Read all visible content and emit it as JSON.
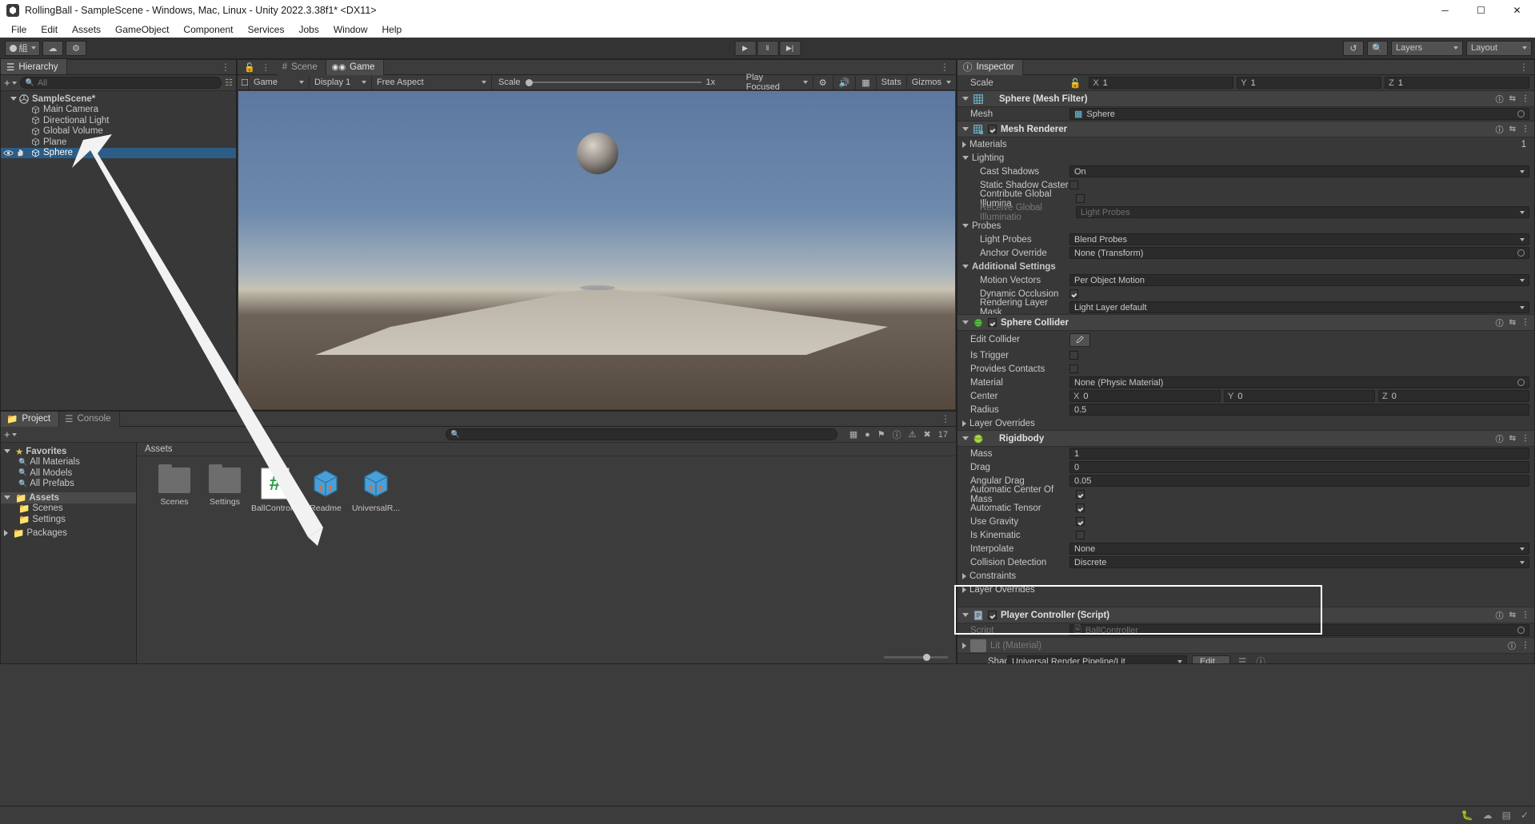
{
  "window": {
    "title": "RollingBall - SampleScene - Windows, Mac, Linux - Unity 2022.3.38f1* <DX11>",
    "minimize": "─",
    "maximize": "☐",
    "close": "✕"
  },
  "menu": [
    "File",
    "Edit",
    "Assets",
    "GameObject",
    "Component",
    "Services",
    "Jobs",
    "Window",
    "Help"
  ],
  "toolbar": {
    "account_label": "組",
    "cloud_label": "☁",
    "settings_label": "⚙",
    "play": "▶",
    "pause": "‖",
    "step": "▶|",
    "history_icon": "history-icon",
    "search_icon": "search-icon",
    "layers_label": "Layers",
    "layout_label": "Layout"
  },
  "hierarchy": {
    "tab": "Hierarchy",
    "search_placeholder": "All",
    "plus_label": "+",
    "items": [
      {
        "label": "SampleScene*",
        "depth": 0,
        "type": "scene",
        "selected": false
      },
      {
        "label": "Main Camera",
        "depth": 1,
        "type": "gameobject",
        "selected": false
      },
      {
        "label": "Directional Light",
        "depth": 1,
        "type": "gameobject",
        "selected": false
      },
      {
        "label": "Global Volume",
        "depth": 1,
        "type": "gameobject",
        "selected": false
      },
      {
        "label": "Plane",
        "depth": 1,
        "type": "gameobject",
        "selected": false
      },
      {
        "label": "Sphere",
        "depth": 1,
        "type": "gameobject",
        "selected": true
      }
    ]
  },
  "gameview": {
    "tabs": [
      {
        "label": "Scene",
        "active": false,
        "icon": "grid-icon"
      },
      {
        "label": "Game",
        "active": true,
        "icon": "gamepad-icon"
      }
    ],
    "view_mode": "Game",
    "display": "Display 1",
    "aspect": "Free Aspect",
    "scale_label": "Scale",
    "scale_value": "1x",
    "play_mode": "Play Focused",
    "stats": "Stats",
    "gizmos": "Gizmos",
    "mute_icon": "audio-icon",
    "stats_icon": "stats-icon"
  },
  "inspector": {
    "tab": "Inspector",
    "scale_row": {
      "label": "Scale",
      "lock_icon": "lock-icon",
      "x_label": "X",
      "x": "1",
      "y_label": "Y",
      "y": "1",
      "z_label": "Z",
      "z": "1"
    },
    "components": [
      {
        "name": "Sphere (Mesh Filter)",
        "icon": "mesh-filter-icon",
        "has_checkbox": false,
        "rows": [
          {
            "label": "Mesh",
            "type": "object",
            "value": "Sphere"
          }
        ]
      },
      {
        "name": "Mesh Renderer",
        "icon": "mesh-renderer-icon",
        "has_checkbox": true,
        "enabled": true,
        "rows": [
          {
            "label": "Materials",
            "type": "foldout_closed",
            "value": "1"
          },
          {
            "label": "Lighting",
            "type": "foldout_open"
          },
          {
            "label": "Cast Shadows",
            "type": "dropdown",
            "value": "On",
            "indent": 2
          },
          {
            "label": "Static Shadow Caster",
            "type": "checkbox",
            "value": false,
            "indent": 2
          },
          {
            "label": "Contribute Global Illumina",
            "type": "checkbox",
            "value": false,
            "indent": 2
          },
          {
            "label": "Receive Global Illuminatio",
            "type": "dropdown",
            "value": "Light Probes",
            "indent": 2,
            "disabled": true
          },
          {
            "label": "Probes",
            "type": "foldout_open"
          },
          {
            "label": "Light Probes",
            "type": "dropdown",
            "value": "Blend Probes",
            "indent": 2
          },
          {
            "label": "Anchor Override",
            "type": "object",
            "value": "None (Transform)",
            "indent": 2
          },
          {
            "label": "Additional Settings",
            "type": "foldout_open"
          },
          {
            "label": "Motion Vectors",
            "type": "dropdown",
            "value": "Per Object Motion",
            "indent": 2
          },
          {
            "label": "Dynamic Occlusion",
            "type": "checkbox",
            "value": true,
            "indent": 2
          },
          {
            "label": "Rendering Layer Mask",
            "type": "dropdown",
            "value": "Light Layer default",
            "indent": 2
          }
        ]
      },
      {
        "name": "Sphere Collider",
        "icon": "collider-icon",
        "has_checkbox": true,
        "enabled": true,
        "rows": [
          {
            "label": "Edit Collider",
            "type": "button",
            "value": "edit-collider-icon"
          },
          {
            "label": "Is Trigger",
            "type": "checkbox",
            "value": false
          },
          {
            "label": "Provides Contacts",
            "type": "checkbox",
            "value": false
          },
          {
            "label": "Material",
            "type": "object",
            "value": "None (Physic Material)"
          },
          {
            "label": "Center",
            "type": "vector3",
            "x": "0",
            "y": "0",
            "z": "0"
          },
          {
            "label": "Radius",
            "type": "text",
            "value": "0.5"
          },
          {
            "label": "Layer Overrides",
            "type": "foldout_closed"
          }
        ]
      },
      {
        "name": "Rigidbody",
        "icon": "rigidbody-icon",
        "has_checkbox": false,
        "rows": [
          {
            "label": "Mass",
            "type": "text",
            "value": "1"
          },
          {
            "label": "Drag",
            "type": "text",
            "value": "0"
          },
          {
            "label": "Angular Drag",
            "type": "text",
            "value": "0.05"
          },
          {
            "label": "Automatic Center Of Mass",
            "type": "checkbox",
            "value": true
          },
          {
            "label": "Automatic Tensor",
            "type": "checkbox",
            "value": true
          },
          {
            "label": "Use Gravity",
            "type": "checkbox",
            "value": true
          },
          {
            "label": "Is Kinematic",
            "type": "checkbox",
            "value": false
          },
          {
            "label": "Interpolate",
            "type": "dropdown",
            "value": "None"
          },
          {
            "label": "Collision Detection",
            "type": "dropdown",
            "value": "Discrete"
          },
          {
            "label": "Constraints",
            "type": "foldout_closed"
          },
          {
            "label": "Layer Overrides",
            "type": "foldout_closed"
          }
        ]
      },
      {
        "name": "Player Controller (Script)",
        "icon": "script-icon",
        "has_checkbox": true,
        "enabled": true,
        "highlighted": true,
        "rows": [
          {
            "label": "Script",
            "type": "object",
            "value": "BallController",
            "disabled": true
          }
        ]
      }
    ],
    "material_preview": {
      "title": "Lit (Material)",
      "shader_label": "Shader",
      "shader_value": "Universal Render Pipeline/Lit",
      "edit_label": "Edit..."
    }
  },
  "project": {
    "tabs": [
      {
        "label": "Project",
        "active": true,
        "icon": "folder-icon"
      },
      {
        "label": "Console",
        "active": false,
        "icon": "console-icon"
      }
    ],
    "plus_label": "+",
    "search_placeholder": "",
    "counter": "17",
    "breadcrumb": "Assets",
    "tree": [
      {
        "label": "Favorites",
        "depth": 0,
        "type": "star",
        "expanded": true
      },
      {
        "label": "All Materials",
        "depth": 1,
        "type": "search"
      },
      {
        "label": "All Models",
        "depth": 1,
        "type": "search"
      },
      {
        "label": "All Prefabs",
        "depth": 1,
        "type": "search"
      },
      {
        "label": "Assets",
        "depth": 0,
        "type": "folder",
        "expanded": true,
        "selected": true
      },
      {
        "label": "Scenes",
        "depth": 1,
        "type": "folder"
      },
      {
        "label": "Settings",
        "depth": 1,
        "type": "folder"
      },
      {
        "label": "Packages",
        "depth": 0,
        "type": "folder",
        "expanded": false
      }
    ],
    "assets": [
      {
        "name": "Scenes",
        "type": "folder"
      },
      {
        "name": "Settings",
        "type": "folder"
      },
      {
        "name": "BallControl...",
        "type": "script"
      },
      {
        "name": "Readme",
        "type": "prefab"
      },
      {
        "name": "UniversalR...",
        "type": "prefab"
      }
    ]
  },
  "statusbar": {
    "icons": [
      "bug-icon",
      "collab-icon",
      "layers-icon",
      "check-icon"
    ]
  },
  "colors": {
    "accent_blue": "#2c5d87",
    "panel_bg": "#383838",
    "header_bg": "#3c3c3c",
    "field_bg": "#2b2b2b",
    "highlight_white": "#ffffff",
    "script_green": "#4ec94e",
    "prefab_blue": "#49a0d8",
    "prefab_orange": "#e06c3a"
  }
}
